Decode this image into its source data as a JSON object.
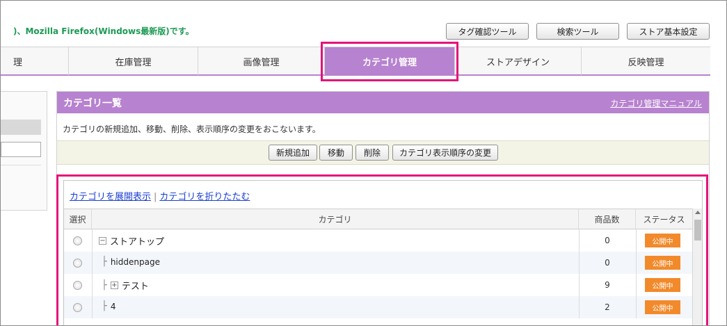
{
  "header": {
    "notice": ")、Mozilla Firefox(Windows最新版)です。",
    "tools": [
      "タグ確認ツール",
      "検索ツール",
      "ストア基本設定"
    ]
  },
  "tabs": [
    {
      "label": "理",
      "active": false
    },
    {
      "label": "在庫管理",
      "active": false
    },
    {
      "label": "画像管理",
      "active": false
    },
    {
      "label": "カテゴリ管理",
      "active": true
    },
    {
      "label": "ストアデザイン",
      "active": false
    },
    {
      "label": "反映管理",
      "active": false
    }
  ],
  "panel": {
    "title": "カテゴリ一覧",
    "manual_link": "カテゴリ管理マニュアル",
    "description": "カテゴリの新規追加、移動、削除、表示順序の変更をおこないます。",
    "actions": [
      "新規追加",
      "移動",
      "削除",
      "カテゴリ表示順序の変更"
    ]
  },
  "list": {
    "expand_link": "カテゴリを展開表示",
    "separator": "|",
    "collapse_link": "カテゴリを折りたたむ",
    "columns": [
      "選択",
      "カテゴリ",
      "商品数",
      "ステータス"
    ],
    "rows": [
      {
        "name": "ストアトップ",
        "prefix": "⊟",
        "branch": false,
        "count": "0",
        "status": "公開中"
      },
      {
        "name": "hiddenpage",
        "prefix": "",
        "branch": true,
        "count": "0",
        "status": "公開中"
      },
      {
        "name": "テスト",
        "prefix": "⊞",
        "branch": true,
        "count": "9",
        "status": "公開中"
      },
      {
        "name": "4",
        "prefix": "",
        "branch": true,
        "count": "2",
        "status": "公開中"
      }
    ]
  },
  "colors": {
    "accent": "#b782cf",
    "highlight": "#e5127a",
    "status": "#f28a2b",
    "notice": "#1e9a55"
  }
}
